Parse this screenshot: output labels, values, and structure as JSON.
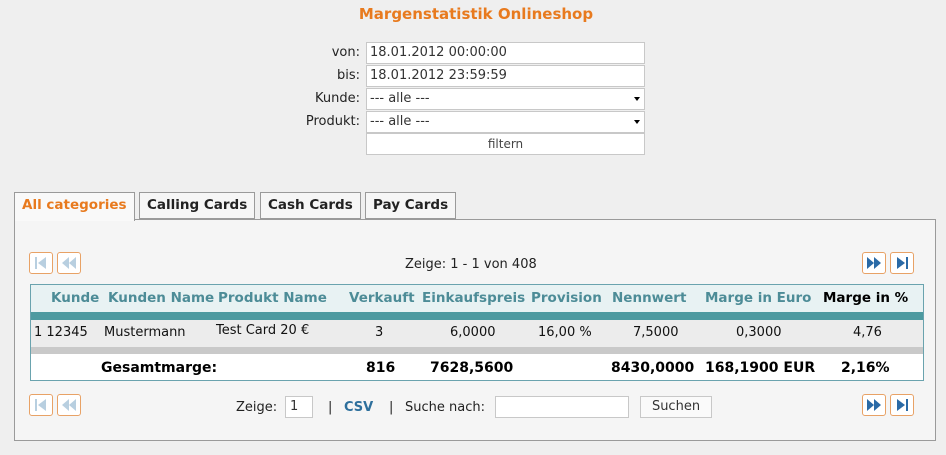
{
  "page": {
    "title": "Margenstatistik Onlineshop"
  },
  "filter": {
    "von_label": "von:",
    "von_value": "18.01.2012 00:00:00",
    "bis_label": "bis:",
    "bis_value": "18.01.2012 23:59:59",
    "kunde_label": "Kunde:",
    "kunde_value": "--- alle ---",
    "produkt_label": "Produkt:",
    "produkt_value": "--- alle ---",
    "filter_button": "filtern"
  },
  "tabs": [
    {
      "label": "All categories",
      "active": true
    },
    {
      "label": "Calling Cards",
      "active": false
    },
    {
      "label": "Cash Cards",
      "active": false
    },
    {
      "label": "Pay Cards",
      "active": false
    }
  ],
  "pager": {
    "info": "Zeige: 1 - 1 von 408"
  },
  "table": {
    "columns": [
      "Kunde",
      "Kunden Name",
      "Produkt Name",
      "Verkauft",
      "Einkaufspreis",
      "Provision",
      "Nennwert",
      "Marge in Euro",
      "Marge in %"
    ],
    "rows": [
      [
        "1 12345",
        "Mustermann",
        "Test Card 20 €",
        "3",
        "6,0000",
        "16,00 %",
        "7,5000",
        "0,3000",
        "4,76"
      ]
    ],
    "totals": {
      "label": "Gesamtmarge:",
      "verkauft": "816",
      "einkaufspreis": "7628,5600",
      "nennwert": "8430,0000",
      "marge_euro": "168,1900 EUR",
      "marge_pct": "2,16%"
    }
  },
  "footer": {
    "zeige_label": "Zeige:",
    "zeige_value": "1",
    "separator": "|",
    "csv_label": "CSV",
    "suche_label": "Suche nach:",
    "suche_value": "",
    "suchen_button": "Suchen"
  },
  "colors": {
    "accent": "#e87a1e",
    "header_text": "#4d8c97",
    "teal_bar": "#4d9aa0",
    "link": "#2d6f9c"
  }
}
